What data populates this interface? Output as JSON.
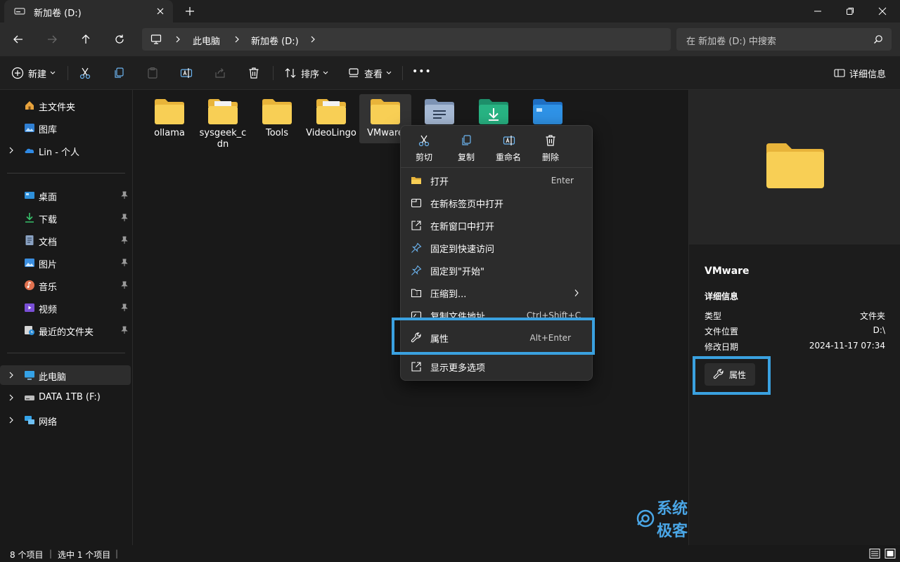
{
  "window": {
    "tab_title": "新加卷 (D:)"
  },
  "address": {
    "crumbs": [
      "此电脑",
      "新加卷 (D:)"
    ],
    "search_placeholder": "在 新加卷 (D:) 中搜索"
  },
  "toolbar": {
    "new_label": "新建",
    "sort_label": "排序",
    "view_label": "查看",
    "more_label": "•••",
    "details_label": "详细信息"
  },
  "sidebar": {
    "quick": [
      {
        "label": "主文件夹",
        "icon": "home-icon"
      },
      {
        "label": "图库",
        "icon": "gallery-icon"
      },
      {
        "label": "Lin - 个人",
        "icon": "onedrive-cloud-icon"
      }
    ],
    "pinned": [
      {
        "label": "桌面",
        "icon": "desktop-icon"
      },
      {
        "label": "下载",
        "icon": "download-icon"
      },
      {
        "label": "文档",
        "icon": "documents-icon"
      },
      {
        "label": "图片",
        "icon": "pictures-icon"
      },
      {
        "label": "音乐",
        "icon": "music-icon"
      },
      {
        "label": "视频",
        "icon": "videos-icon"
      },
      {
        "label": "最近的文件夹",
        "icon": "recent-folders-icon"
      }
    ],
    "drives": [
      {
        "label": "此电脑",
        "icon": "this-pc-icon"
      },
      {
        "label": "DATA 1TB (F:)",
        "icon": "drive-icon"
      },
      {
        "label": "网络",
        "icon": "network-icon"
      }
    ]
  },
  "files": [
    {
      "name": "ollama"
    },
    {
      "name": "sysgeek_cdn"
    },
    {
      "name": "Tools"
    },
    {
      "name": "VideoLingo"
    },
    {
      "name": "VMware"
    },
    {
      "name": ""
    },
    {
      "name": ""
    },
    {
      "name": ""
    }
  ],
  "context_menu": {
    "quick_actions": [
      {
        "label": "剪切",
        "icon": "scissors-icon"
      },
      {
        "label": "复制",
        "icon": "copy-icon"
      },
      {
        "label": "重命名",
        "icon": "rename-icon"
      },
      {
        "label": "删除",
        "icon": "trash-icon"
      }
    ],
    "items": [
      {
        "label": "打开",
        "shortcut": "Enter",
        "icon": "folder-open-icon"
      },
      {
        "label": "在新标签页中打开",
        "shortcut": "",
        "icon": "new-tab-icon"
      },
      {
        "label": "在新窗口中打开",
        "shortcut": "",
        "icon": "new-window-icon"
      },
      {
        "label": "固定到快速访问",
        "shortcut": "",
        "icon": "pin-icon"
      },
      {
        "label": "固定到\"开始\"",
        "shortcut": "",
        "icon": "pin-start-icon"
      },
      {
        "label": "压缩到...",
        "shortcut": "",
        "icon": "zip-icon"
      },
      {
        "label": "复制文件地址",
        "shortcut": "Ctrl+Shift+C",
        "icon": "copy-path-icon"
      },
      {
        "label": "属性",
        "shortcut": "Alt+Enter",
        "icon": "wrench-icon"
      },
      {
        "label": "显示更多选项",
        "shortcut": "",
        "icon": "more-options-icon"
      }
    ]
  },
  "details_pane": {
    "name": "VMware",
    "section": "详细信息",
    "rows": [
      {
        "key": "类型",
        "value": "文件夹"
      },
      {
        "key": "文件位置",
        "value": "D:\\"
      },
      {
        "key": "修改日期",
        "value": "2024-11-17 07:34"
      }
    ],
    "properties_button": "属性"
  },
  "status": {
    "count": "8 个项目",
    "selected": "选中 1 个项目"
  },
  "watermark": "系统极客",
  "colors": {
    "highlight": "#3aa1e0",
    "folder": "#f4c542",
    "background": "#191919"
  }
}
